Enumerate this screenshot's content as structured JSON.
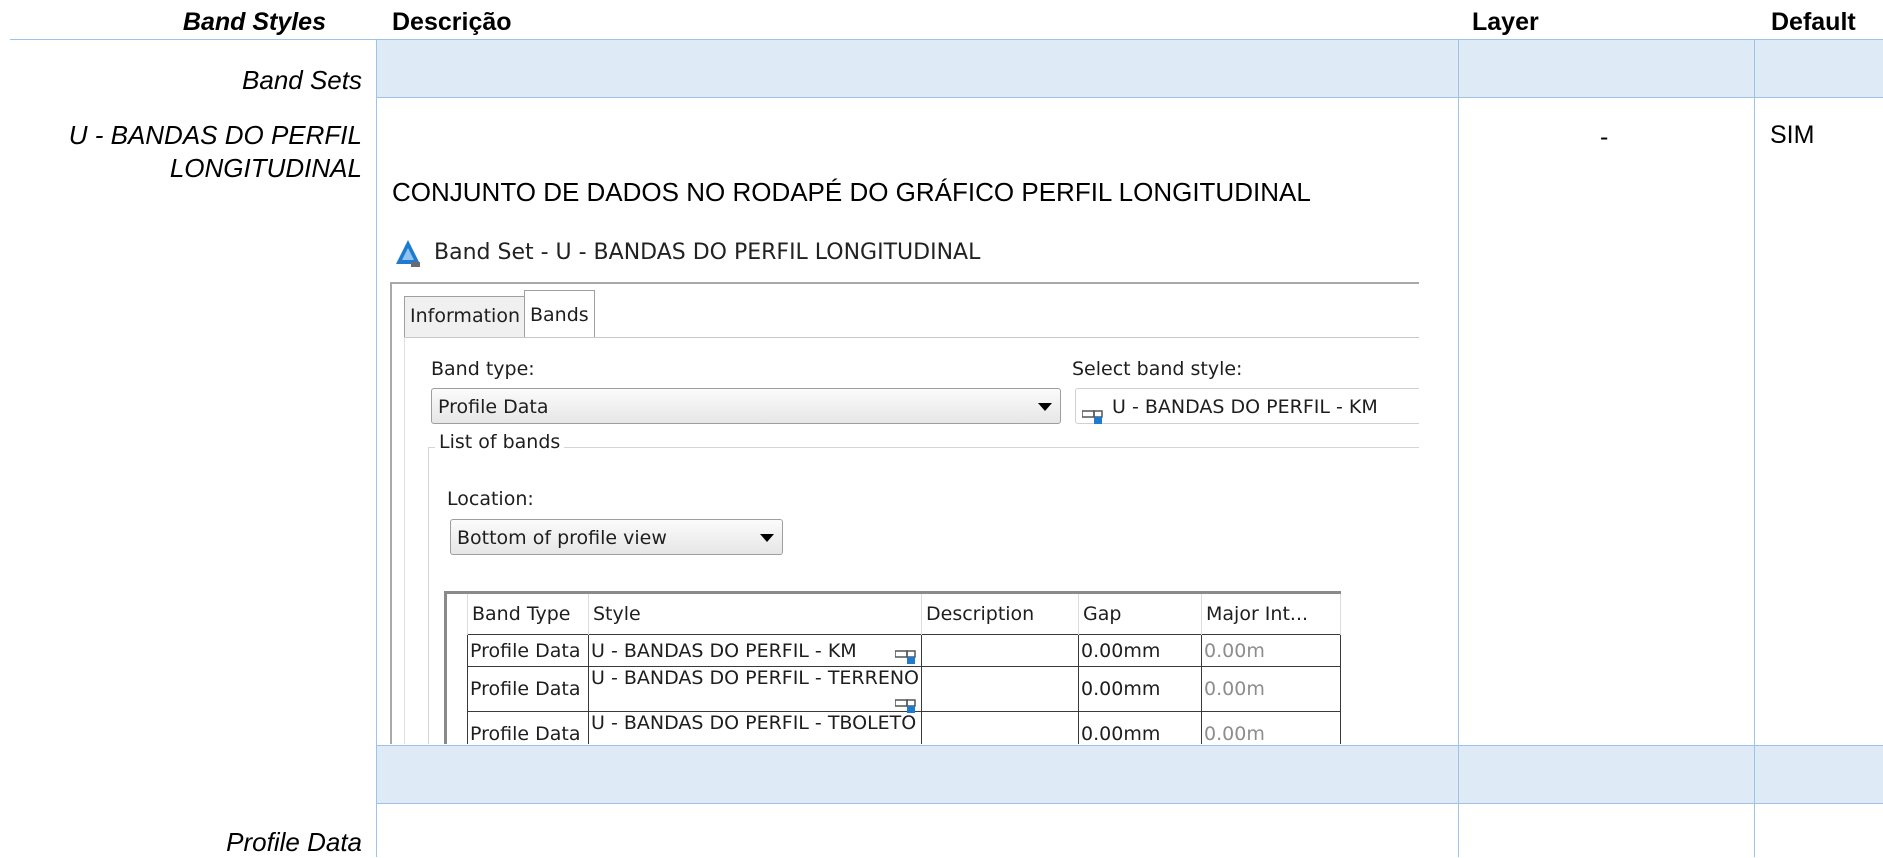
{
  "headers": {
    "band_styles": "Band Styles",
    "descricao": "Descrição",
    "layer": "Layer",
    "default": "Default"
  },
  "rows": {
    "band_sets": "Band Sets",
    "bandas_line1": "U - BANDAS DO PERFIL",
    "bandas_line2": "LONGITUDINAL",
    "bandas_description": "CONJUNTO DE DADOS NO RODAPÉ DO GRÁFICO PERFIL LONGITUDINAL",
    "bandas_layer": "-",
    "bandas_default": "SIM",
    "profile_data": "Profile Data"
  },
  "dialog": {
    "title": "Band Set - U - BANDAS DO PERFIL LONGITUDINAL",
    "tabs": [
      "Information",
      "Bands"
    ],
    "active_tab": "Bands",
    "band_type_label": "Band type:",
    "band_type_value": "Profile Data",
    "select_band_style_label": "Select band style:",
    "select_band_style_value": "U - BANDAS DO PERFIL - KM",
    "list_of_bands_label": "List of bands",
    "location_label": "Location:",
    "location_value": "Bottom of profile view",
    "columns": [
      "Band Type",
      "Style",
      "Description",
      "Gap",
      "Major Int..."
    ],
    "bands": [
      {
        "type": "Profile Data",
        "style": "U - BANDAS DO PERFIL - KM",
        "description": "",
        "gap": "0.00mm",
        "major": "0.00m"
      },
      {
        "type": "Profile Data",
        "style": "U - BANDAS DO PERFIL - TERRENO",
        "description": "",
        "gap": "0.00mm",
        "major": "0.00m"
      },
      {
        "type": "Profile Data",
        "style": "U - BANDAS DO PERFIL - TBOLETO",
        "description": "",
        "gap": "0.00mm",
        "major": "0.00m"
      }
    ]
  },
  "colors": {
    "header_rule": "#9dc3e6",
    "shade": "#deeaf6",
    "civil3d_icon": "#1e7bd0"
  }
}
